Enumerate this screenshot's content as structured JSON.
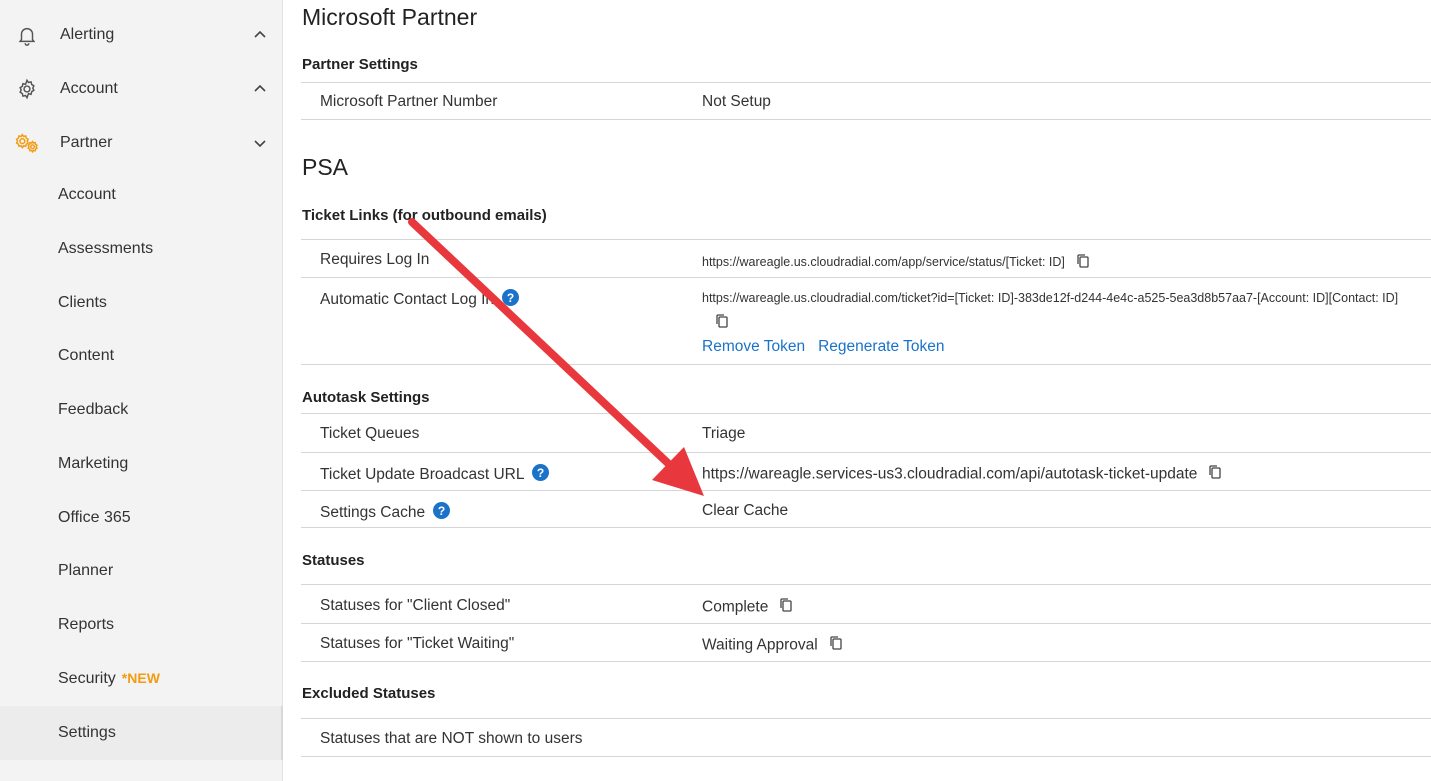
{
  "sidebar": {
    "parents": [
      {
        "label": "Alerting",
        "icon": "bell-icon"
      },
      {
        "label": "Account",
        "icon": "gear-icon"
      },
      {
        "label": "Partner",
        "icon": "gears-icon"
      }
    ],
    "children": [
      {
        "label": "Account"
      },
      {
        "label": "Assessments"
      },
      {
        "label": "Clients"
      },
      {
        "label": "Content"
      },
      {
        "label": "Feedback"
      },
      {
        "label": "Marketing"
      },
      {
        "label": "Office 365"
      },
      {
        "label": "Planner"
      },
      {
        "label": "Reports"
      },
      {
        "label": "Security",
        "badge": "*NEW"
      },
      {
        "label": "Settings"
      }
    ],
    "accent_color": "#f39c12"
  },
  "main": {
    "microsoft_partner_title": "Microsoft Partner",
    "partner_settings_title": "Partner Settings",
    "partner_number_label": "Microsoft Partner Number",
    "partner_number_value": "Not Setup",
    "psa_title": "PSA",
    "ticket_links_title": "Ticket Links (for outbound emails)",
    "requires_login_label": "Requires Log In",
    "requires_login_value": "https://wareagle.us.cloudradial.com/app/service/status/[Ticket: ID]",
    "auto_login_label": "Automatic Contact Log In",
    "auto_login_value": "https://wareagle.us.cloudradial.com/ticket?id=[Ticket: ID]-383de12f-d244-4e4c-a525-5ea3d8b57aa7-[Account: ID][Contact: ID]",
    "remove_token": "Remove Token",
    "regenerate_token": "Regenerate Token",
    "autotask_title": "Autotask Settings",
    "ticket_queues_label": "Ticket Queues",
    "ticket_queues_value": "Triage",
    "broadcast_label": "Ticket Update Broadcast URL",
    "broadcast_value": "https://wareagle.services-us3.cloudradial.com/api/autotask-ticket-update",
    "settings_cache_label": "Settings Cache",
    "clear_cache": "Clear Cache",
    "statuses_title": "Statuses",
    "client_closed_label": "Statuses for \"Client Closed\"",
    "client_closed_value": "Complete",
    "ticket_waiting_label": "Statuses for \"Ticket Waiting\"",
    "ticket_waiting_value": "Waiting Approval",
    "excluded_title": "Excluded Statuses",
    "excluded_label": "Statuses that are NOT shown to users"
  },
  "colors": {
    "link": "#1a73c8",
    "help": "#1a73c8",
    "annotation_arrow": "#e8383d"
  }
}
